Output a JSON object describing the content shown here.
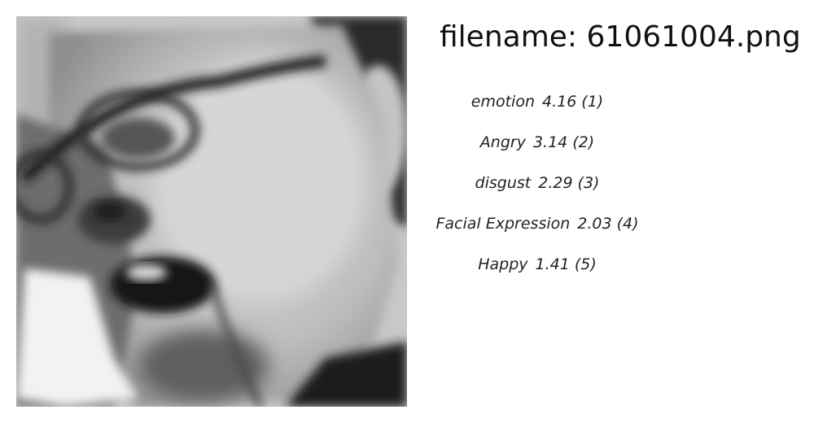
{
  "header": {
    "filename_prefix": "filename:",
    "filename": "61061004.png"
  },
  "image": {
    "icon": "grayscale-face-photo",
    "tone": "grayscale"
  },
  "predictions": [
    {
      "label": "emotion",
      "score": "4.16",
      "rank": "(1)"
    },
    {
      "label": "Angry",
      "score": "3.14",
      "rank": "(2)"
    },
    {
      "label": "disgust",
      "score": "2.29",
      "rank": "(3)"
    },
    {
      "label": "Facial Expression",
      "score": "2.03",
      "rank": "(4)"
    },
    {
      "label": "Happy",
      "score": "1.41",
      "rank": "(5)"
    }
  ]
}
